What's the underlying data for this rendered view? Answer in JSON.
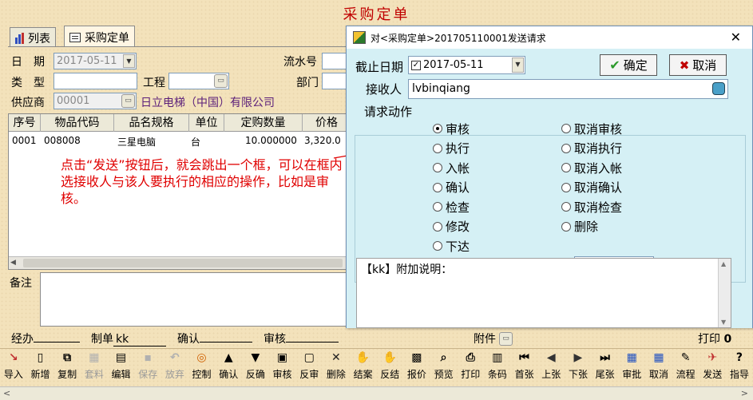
{
  "page_title": "采购定单",
  "tabs": [
    {
      "label": "列表",
      "icon": "bar-chart-icon"
    },
    {
      "label": "采购定单",
      "icon": "form-icon"
    }
  ],
  "form": {
    "date_label": "日　期",
    "date_value": "2017-05-11",
    "serial_label": "流水号",
    "type_label": "类　型",
    "project_label": "工程",
    "dept_label": "部门",
    "supplier_label": "供应商",
    "supplier_code": "00001",
    "supplier_name": "日立电梯（中国）有限公司"
  },
  "grid": {
    "headers": [
      "序号",
      "物品代码",
      "品名规格",
      "单位",
      "定购数量",
      "价格"
    ],
    "rows": [
      [
        "0001",
        "008008",
        "三星电脑",
        "台",
        "10.000000",
        "3,320.0"
      ]
    ]
  },
  "annotation": "点击“发送”按钮后，就会跳出一个框，可以在框内选接收人与该人要执行的相应的操作，比如是审核。",
  "remark_label": "备注",
  "footer": {
    "handler_label": "经办",
    "maker_label": "制单",
    "maker_value": "kk",
    "confirm_label": "确认",
    "audit_label": "审核",
    "attachment_label": "附件",
    "print_label": "打印",
    "print_count": "0"
  },
  "toolbar": [
    {
      "label": "导入",
      "icon": "import-icon",
      "enabled": true
    },
    {
      "label": "新增",
      "icon": "new-doc-icon",
      "enabled": true
    },
    {
      "label": "复制",
      "icon": "copy-icon",
      "enabled": true
    },
    {
      "label": "套料",
      "icon": "material-icon",
      "enabled": false
    },
    {
      "label": "编辑",
      "icon": "edit-icon",
      "enabled": true
    },
    {
      "label": "保存",
      "icon": "save-icon",
      "enabled": false
    },
    {
      "label": "放弃",
      "icon": "undo-icon",
      "enabled": false
    },
    {
      "label": "控制",
      "icon": "control-icon",
      "enabled": true
    },
    {
      "label": "确认",
      "icon": "confirm-icon",
      "enabled": true
    },
    {
      "label": "反确",
      "icon": "unconfirm-icon",
      "enabled": true
    },
    {
      "label": "审核",
      "icon": "audit-icon",
      "enabled": true
    },
    {
      "label": "反审",
      "icon": "unaudit-icon",
      "enabled": true
    },
    {
      "label": "删除",
      "icon": "delete-icon",
      "enabled": true
    },
    {
      "label": "结案",
      "icon": "close-case-icon",
      "enabled": true
    },
    {
      "label": "反结",
      "icon": "reopen-icon",
      "enabled": true
    },
    {
      "label": "报价",
      "icon": "quote-icon",
      "enabled": true
    },
    {
      "label": "预览",
      "icon": "preview-icon",
      "enabled": true
    },
    {
      "label": "打印",
      "icon": "print-icon",
      "enabled": true
    },
    {
      "label": "条码",
      "icon": "barcode-icon",
      "enabled": true
    },
    {
      "label": "首张",
      "icon": "first-icon",
      "enabled": true
    },
    {
      "label": "上张",
      "icon": "prev-icon",
      "enabled": true
    },
    {
      "label": "下张",
      "icon": "next-icon",
      "enabled": true
    },
    {
      "label": "尾张",
      "icon": "last-icon",
      "enabled": true
    },
    {
      "label": "审批",
      "icon": "approve-icon",
      "enabled": true
    },
    {
      "label": "取消",
      "icon": "cancel-icon",
      "enabled": true
    },
    {
      "label": "流程",
      "icon": "flow-icon",
      "enabled": true
    },
    {
      "label": "发送",
      "icon": "send-icon",
      "enabled": true
    },
    {
      "label": "指导",
      "icon": "help-icon",
      "enabled": true
    }
  ],
  "dialog": {
    "title": "对<采购定单>201705110001发送请求",
    "deadline_label": "截止日期",
    "deadline_value": "2017-05-11",
    "confirm_button": "确定",
    "cancel_button": "取消",
    "receiver_label": "接收人",
    "receiver_value": "lvbinqiang",
    "action_group_label": "请求动作",
    "actions_left": [
      "审核",
      "执行",
      "入帐",
      "确认",
      "检查",
      "修改",
      "下达"
    ],
    "actions_right": [
      "取消审核",
      "取消执行",
      "取消入帐",
      "取消确认",
      "取消检查",
      "删除"
    ],
    "selected_action": "审核",
    "note_text": "【kk】附加说明：",
    "colors": {
      "title_bg": "#ffffff",
      "body_bg": "#d5f0f5",
      "accent_red": "#e00000"
    }
  }
}
